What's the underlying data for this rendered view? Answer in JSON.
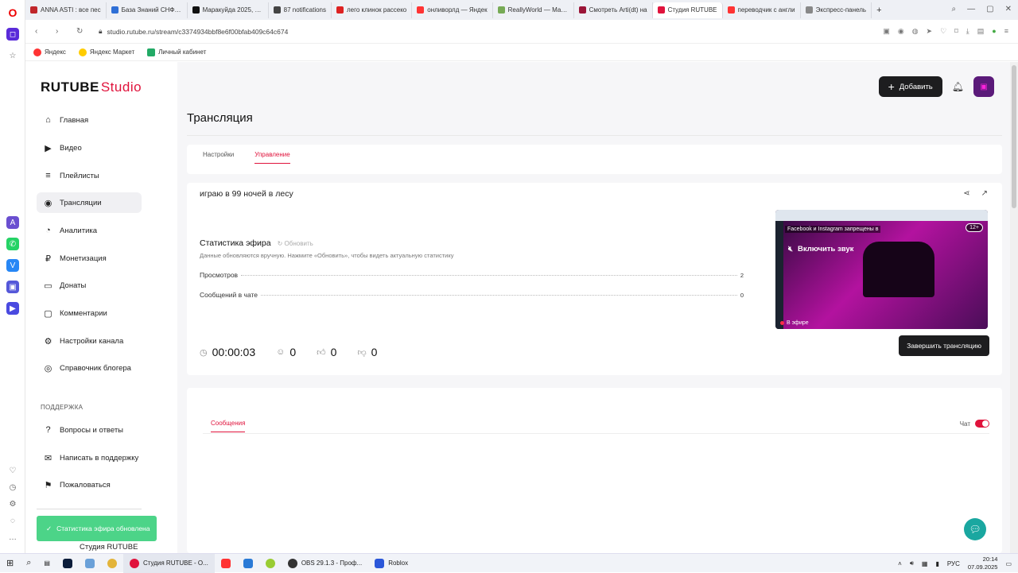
{
  "browser": {
    "tabs": [
      {
        "title": "ANNA ASTI : все пес",
        "color": "#c0262b"
      },
      {
        "title": "База Знаний СНФПС",
        "color": "#2f6fd6"
      },
      {
        "title": "Маракуйда 2025, Рос",
        "color": "#111111"
      },
      {
        "title": "87 notifications",
        "color": "#444444"
      },
      {
        "title": "лего клинок рассеко",
        "color": "#d22"
      },
      {
        "title": "онливорлд — Яндек",
        "color": "#f33"
      },
      {
        "title": "ReallyWorld — Магаз",
        "color": "#7a5"
      },
      {
        "title": "Смотреть Arti(dt) на",
        "color": "#9b1538"
      },
      {
        "title": "Студия RUTUBE",
        "color": "#e0133c",
        "active": true
      },
      {
        "title": "переводчик с англи",
        "color": "#f33"
      },
      {
        "title": "Экспресс-панель",
        "color": "#888888"
      }
    ],
    "url": "studio.rutube.ru/stream/c3374934bbf8e6f00bfab409c64c674",
    "bookmarks": [
      "Яндекс",
      "Яндекс Маркет",
      "Личный кабинет"
    ]
  },
  "brand": {
    "name": "RUTUBE",
    "suffix": "Studio"
  },
  "header": {
    "add_label": "Добавить",
    "avatar_text": "▣"
  },
  "sidebar": {
    "items": [
      {
        "label": "Главная",
        "icon": "⌂"
      },
      {
        "label": "Видео",
        "icon": "▶"
      },
      {
        "label": "Плейлисты",
        "icon": "≡"
      },
      {
        "label": "Трансляции",
        "icon": "◉"
      },
      {
        "label": "Аналитика",
        "icon": "◔"
      },
      {
        "label": "Монетизация",
        "icon": "₽"
      },
      {
        "label": "Донаты",
        "icon": "▭"
      },
      {
        "label": "Комментарии",
        "icon": "▢"
      },
      {
        "label": "Настройки канала",
        "icon": "⚙"
      },
      {
        "label": "Справочник блогера",
        "icon": "◎"
      }
    ],
    "support_title": "ПОДДЕРЖКА",
    "support_items": [
      {
        "label": "Вопросы и ответы",
        "icon": "?"
      },
      {
        "label": "Написать в поддержку",
        "icon": "✉"
      },
      {
        "label": "Пожаловаться",
        "icon": "⚑"
      }
    ],
    "bottom_item": "Студия RUTUBE"
  },
  "toast": {
    "text": "Статистика эфира обновлена"
  },
  "main": {
    "title": "Трансляция",
    "tabs": [
      "Настройки",
      "Управление"
    ],
    "stream_name": "играю в 99 ночей в лесу",
    "stats": {
      "title": "Статистика эфира",
      "refresh_label": "Обновить",
      "note": "Данные обновляются вручную. Нажмите «Обновить», чтобы видеть актуальную статистику",
      "rows": [
        {
          "label": "Просмотров",
          "value": "2"
        },
        {
          "label": "Сообщений в чате",
          "value": "0"
        }
      ]
    },
    "metrics": {
      "duration": "00:00:03",
      "viewers": "0",
      "likes": "0",
      "dislikes": "0"
    },
    "preview": {
      "banner": "Facebook и Instagram запрещены в",
      "age": "12+",
      "mute_label": "Включить звук",
      "live_label": "В эфире"
    },
    "end_label": "Завершить трансляцию",
    "chat": {
      "tab_label": "Сообщения",
      "toggle_label": "Чат"
    }
  },
  "taskbar": {
    "items": [
      {
        "label": "Студия RUTUBE - О...",
        "color": "#e0133c"
      },
      {
        "label": "OBS 29.1.3 - Проф...",
        "color": "#333333"
      },
      {
        "label": "Roblox",
        "color": "#2b57d9"
      }
    ],
    "lang": "РУС",
    "time": "20:14",
    "date": "07.09.2025"
  }
}
